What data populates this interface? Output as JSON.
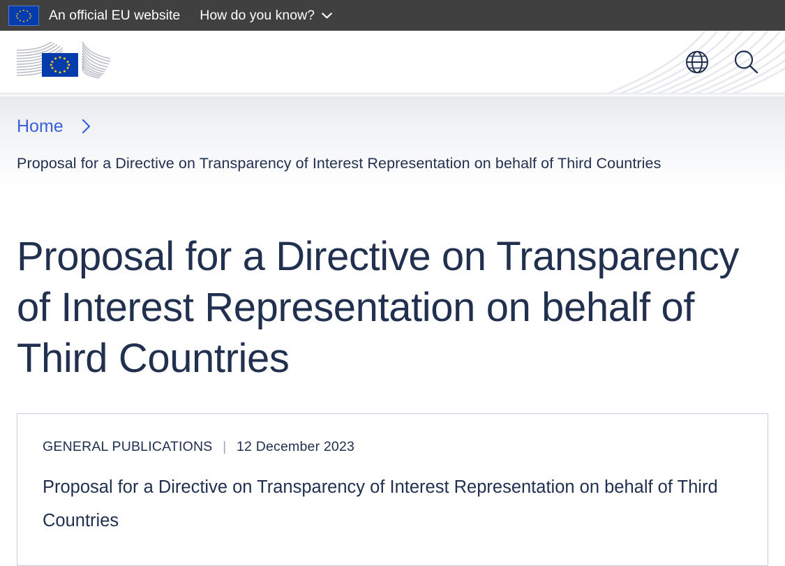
{
  "top_bar": {
    "flag_icon": "eu-flag-icon",
    "official_text": "An official EU website",
    "how_link": "How do you know?",
    "chevron_icon": "chevron-down-icon",
    "background_color": "#404040"
  },
  "header": {
    "logo_name": "european-commission-logo",
    "language_icon": "globe-icon",
    "search_icon": "search-icon"
  },
  "breadcrumb": {
    "home_label": "Home",
    "separator_icon": "chevron-right-icon",
    "current": "Proposal for a Directive on Transparency of Interest Representation on behalf of Third Countries",
    "link_color": "#3a5fd9"
  },
  "main": {
    "page_title": "Proposal for a Directive on Transparency of Interest Representation on behalf of Third Countries",
    "card": {
      "category": "GENERAL PUBLICATIONS",
      "separator": "|",
      "date": "12 December 2023",
      "title": "Proposal for a Directive on Transparency of Interest Representation on behalf of Third Countries",
      "border_color": "#c5cde4"
    }
  },
  "colors": {
    "text_navy": "#21304e",
    "eu_blue": "#043CAE",
    "star_yellow": "#FFCC00"
  }
}
